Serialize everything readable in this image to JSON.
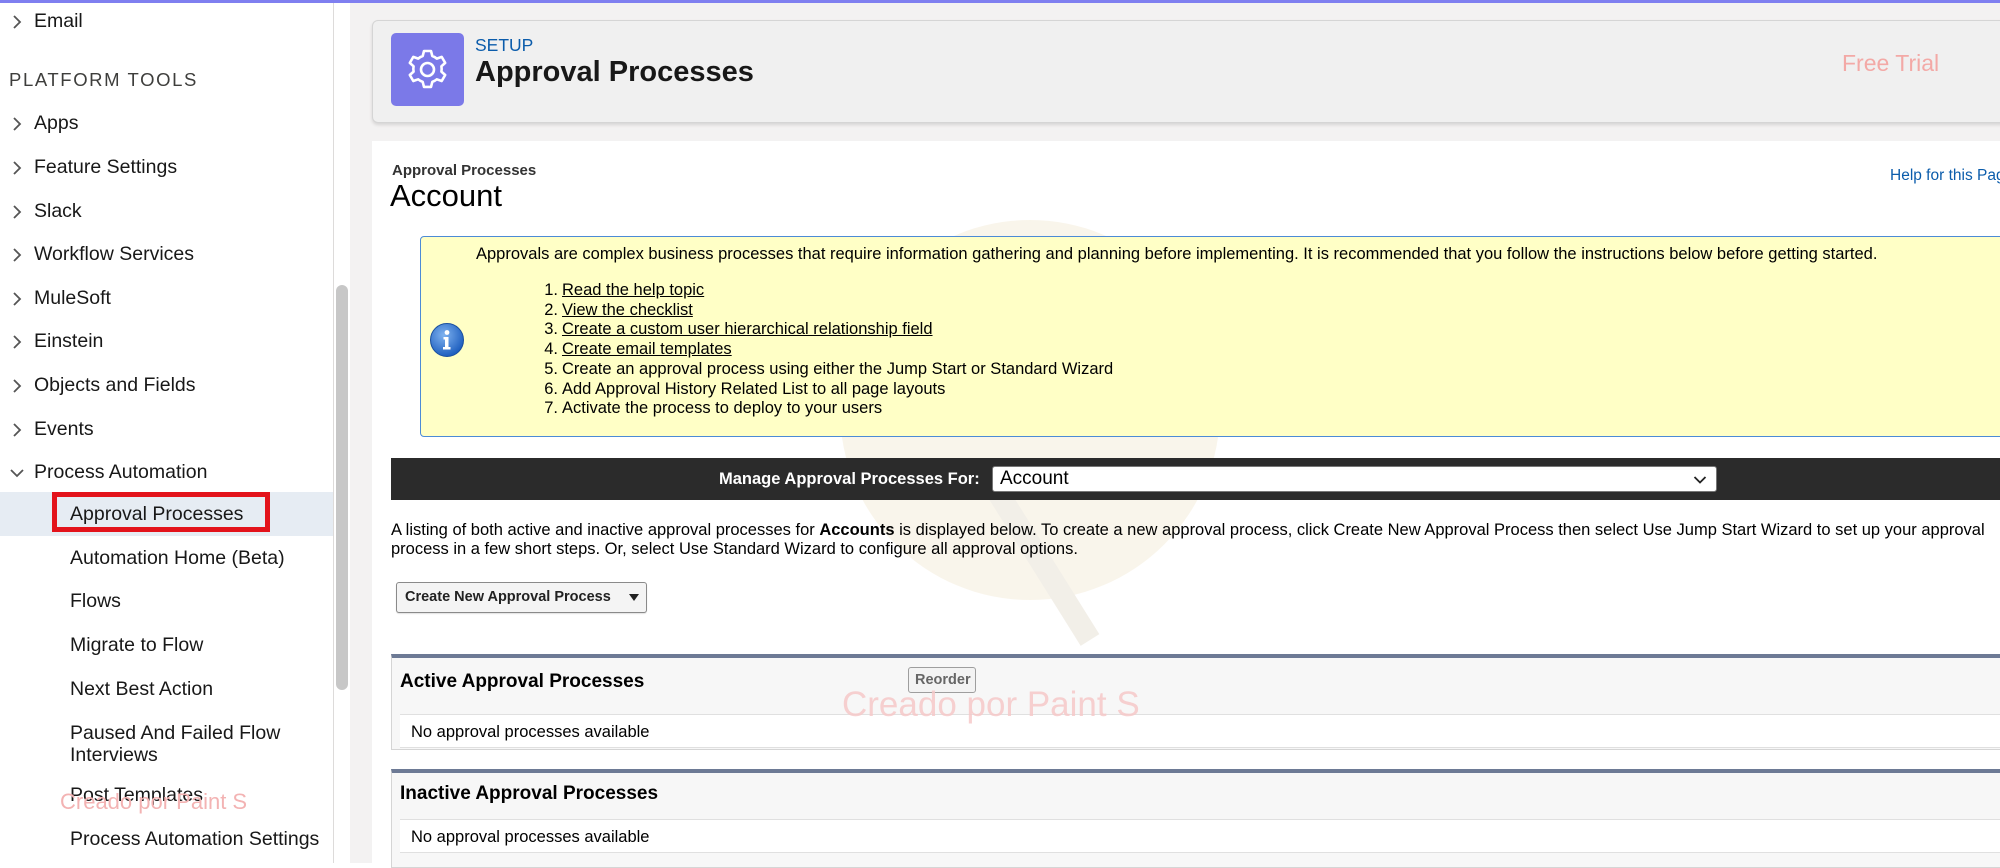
{
  "colors": {
    "accent_icon": "#7b79e8",
    "link": "#0b5cab",
    "info_bg": "#ffffc6",
    "info_border": "#4c8bd6",
    "manage_bar_bg": "#2b2b2b",
    "highlight_box": "#e3131b",
    "top_line": "#7f7ff0"
  },
  "sidebar": {
    "top_item": {
      "label": "Email",
      "icon": "chevron-right-icon"
    },
    "section_heading": "PLATFORM TOOLS",
    "items": [
      {
        "label": "Apps",
        "icon": "chevron-right-icon"
      },
      {
        "label": "Feature Settings",
        "icon": "chevron-right-icon"
      },
      {
        "label": "Slack",
        "icon": "chevron-right-icon"
      },
      {
        "label": "Workflow Services",
        "icon": "chevron-right-icon"
      },
      {
        "label": "MuleSoft",
        "icon": "chevron-right-icon"
      },
      {
        "label": "Einstein",
        "icon": "chevron-right-icon"
      },
      {
        "label": "Objects and Fields",
        "icon": "chevron-right-icon"
      },
      {
        "label": "Events",
        "icon": "chevron-right-icon"
      },
      {
        "label": "Process Automation",
        "icon": "chevron-down-icon",
        "expanded": true
      }
    ],
    "subitems": [
      {
        "label": "Approval Processes",
        "selected": true
      },
      {
        "label": "Automation Home (Beta)"
      },
      {
        "label": "Flows"
      },
      {
        "label": "Migrate to Flow"
      },
      {
        "label": "Next Best Action"
      },
      {
        "label": "Paused And Failed Flow Interviews"
      },
      {
        "label": "Post Templates"
      },
      {
        "label": "Process Automation Settings"
      }
    ],
    "watermark": "Creado por Paint S"
  },
  "header": {
    "icon": "gear-icon",
    "setup_label": "SETUP",
    "title": "Approval Processes",
    "free_trial": "Free Trial"
  },
  "content": {
    "breadcrumb": "Approval Processes",
    "page_title": "Account",
    "help_link": "Help for this Pag",
    "info": {
      "icon": "info-icon",
      "intro": "Approvals are complex business processes that require information gathering and planning before implementing. It is recommended that you follow the instructions below before getting started.",
      "steps": [
        {
          "num": "1.",
          "text": "Read the help topic",
          "link": true
        },
        {
          "num": "2.",
          "text": "View the checklist",
          "link": true
        },
        {
          "num": "3.",
          "text": "Create a custom user hierarchical relationship field",
          "link": true
        },
        {
          "num": "4.",
          "text": "Create email templates",
          "link": true
        },
        {
          "num": "5.",
          "text": "Create an approval process using either the Jump Start or Standard Wizard",
          "link": false
        },
        {
          "num": "6.",
          "text": "Add Approval History Related List to all page layouts",
          "link": false
        },
        {
          "num": "7.",
          "text": "Activate the process to deploy to your users",
          "link": false
        }
      ]
    },
    "manage": {
      "label": "Manage Approval Processes For:",
      "selected": "Account",
      "icon": "chevron-down-icon"
    },
    "description": {
      "before": "A listing of both active and inactive approval processes for ",
      "bold": "Accounts",
      "after": " is displayed below. To create a new approval process, click Create New Approval Process then select Use Jump Start Wizard to set up your approval process in a few short steps. Or, select Use Standard Wizard to configure all approval options."
    },
    "create_button": "Create New Approval Process",
    "active": {
      "title": "Active Approval Processes",
      "reorder": "Reorder",
      "empty": "No approval processes available"
    },
    "inactive": {
      "title": "Inactive Approval Processes",
      "empty": "No approval processes available"
    },
    "watermark": "Creado por Paint S"
  }
}
